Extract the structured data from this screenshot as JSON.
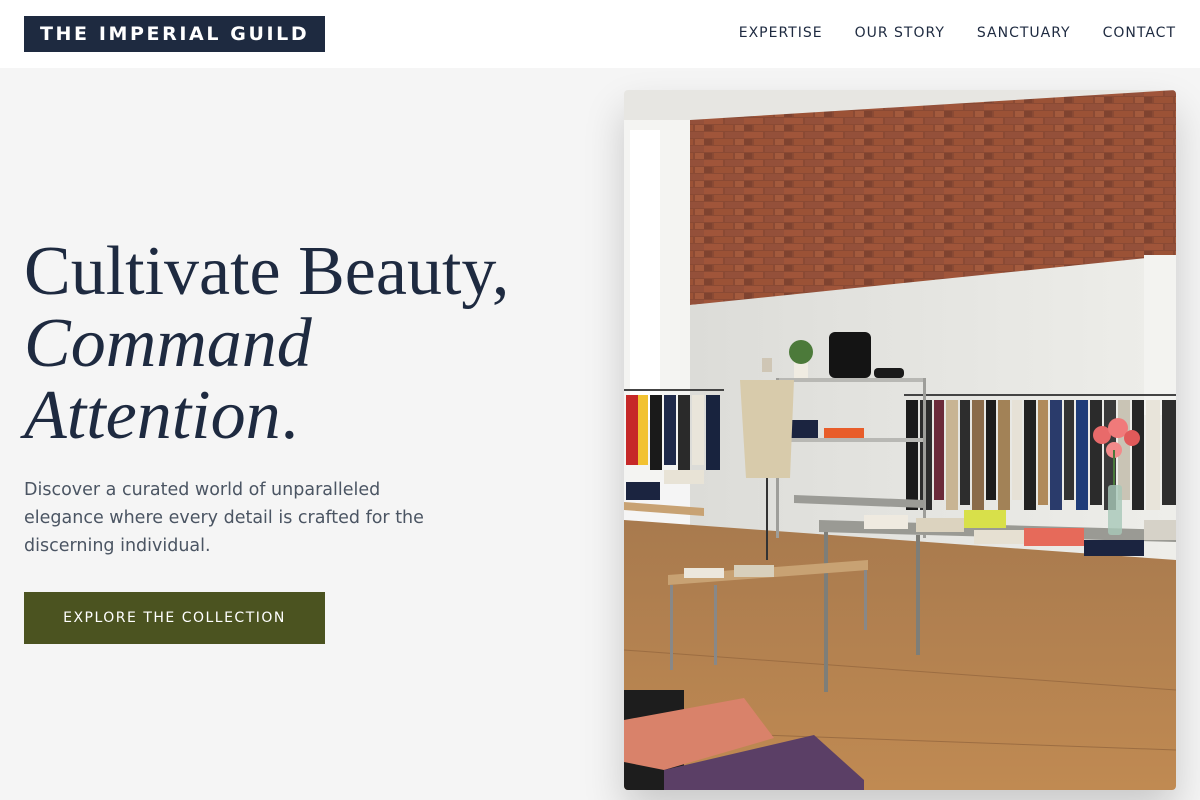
{
  "header": {
    "logo": "THE IMPERIAL GUILD",
    "nav": [
      {
        "label": "EXPERTISE"
      },
      {
        "label": "OUR STORY"
      },
      {
        "label": "SANCTUARY"
      },
      {
        "label": "CONTACT"
      }
    ]
  },
  "hero": {
    "title_line1": "Cultivate Beauty,",
    "title_line2": "Command",
    "title_line3": "Attention",
    "title_period": ".",
    "description": "Discover a curated world of unparalleled elegance where every detail is crafted for the discerning individual.",
    "cta_label": "EXPLORE THE COLLECTION"
  },
  "colors": {
    "brand_navy": "#1e2a40",
    "cta_olive": "#4b5320",
    "background": "#f5f5f5"
  }
}
